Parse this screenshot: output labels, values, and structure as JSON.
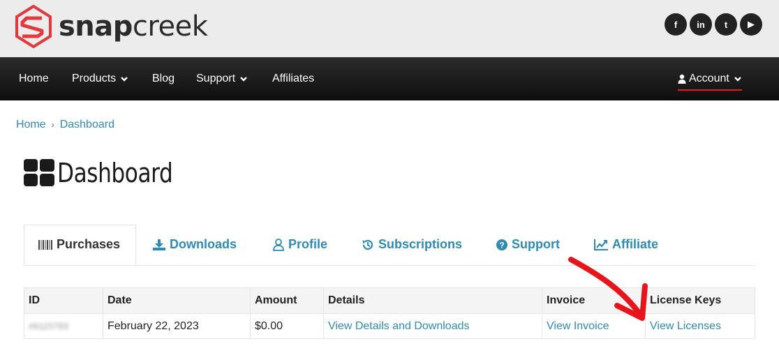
{
  "brand": {
    "word1": "snap",
    "word2": "creek"
  },
  "social": [
    {
      "label": "f",
      "icon": "facebook-icon"
    },
    {
      "label": "in",
      "icon": "linkedin-icon"
    },
    {
      "label": "t",
      "icon": "twitter-icon"
    },
    {
      "label": "▶",
      "icon": "youtube-icon"
    }
  ],
  "nav": {
    "items": [
      "Home",
      "Products",
      "Blog",
      "Support",
      "Affiliates"
    ],
    "account": "Account"
  },
  "breadcrumb": {
    "home": "Home",
    "separator": "›",
    "current": "Dashboard"
  },
  "page": {
    "title": "Dashboard"
  },
  "tabs": [
    "Purchases",
    "Downloads",
    "Profile",
    "Subscriptions",
    "Support",
    "Affiliate"
  ],
  "table": {
    "headers": [
      "ID",
      "Date",
      "Amount",
      "Details",
      "Invoice",
      "License Keys"
    ],
    "row": {
      "id": "#6115783",
      "date": "February 22, 2023",
      "amount": "$0.00",
      "details": "View Details and Downloads",
      "invoice": "View Invoice",
      "license": "View Licenses"
    }
  },
  "colors": {
    "link": "#2e8bb5",
    "accent": "#e02020",
    "header_bg": "#ececec",
    "nav_bg": "#1a1a1a"
  }
}
